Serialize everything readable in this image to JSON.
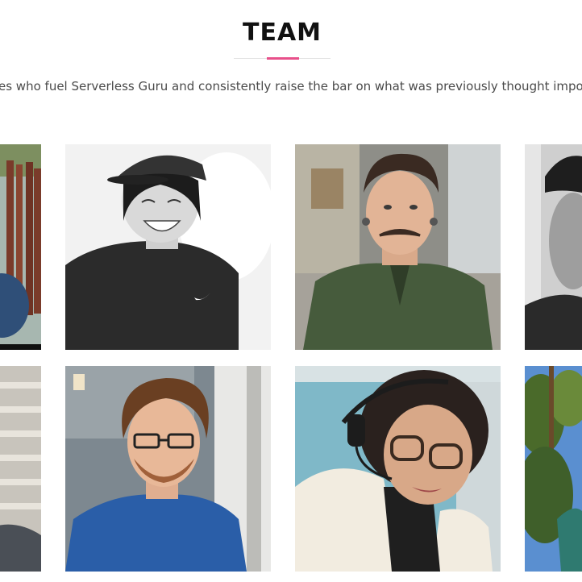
{
  "section": {
    "title": "TEAM",
    "subtitle": "es who fuel Serverless Guru and consistently raise the bar on what was previously thought imposs",
    "accent_color": "#e8508a"
  },
  "team": {
    "photos": [
      {
        "row": 1,
        "col": 1,
        "style": "color",
        "subject": "man-near-wooden-fence"
      },
      {
        "row": 1,
        "col": 2,
        "style": "black-and-white",
        "subject": "smiling-woman-cap"
      },
      {
        "row": 1,
        "col": 3,
        "style": "color",
        "subject": "man-mustache-green-shirt"
      },
      {
        "row": 1,
        "col": 4,
        "style": "black-and-white",
        "subject": "man-cap"
      },
      {
        "row": 2,
        "col": 1,
        "style": "color",
        "subject": "man-gray-shirt"
      },
      {
        "row": 2,
        "col": 2,
        "style": "color",
        "subject": "man-glasses-blue-shirt"
      },
      {
        "row": 2,
        "col": 3,
        "style": "color",
        "subject": "woman-headset-glasses"
      },
      {
        "row": 2,
        "col": 4,
        "style": "color",
        "subject": "person-outdoors-trees"
      }
    ]
  }
}
